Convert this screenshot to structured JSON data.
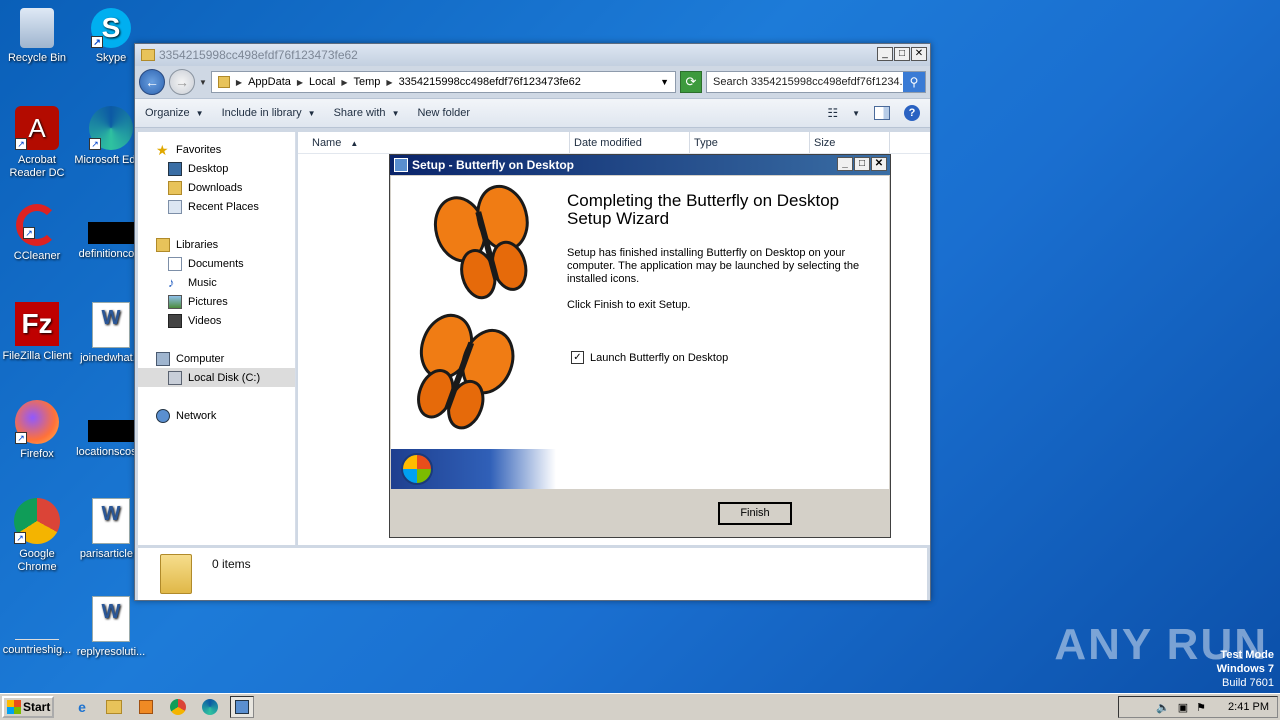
{
  "desktop": {
    "icons": [
      {
        "label": "Recycle Bin"
      },
      {
        "label": "Skype"
      },
      {
        "label": "Acrobat Reader DC"
      },
      {
        "label": "Microsoft Edge"
      },
      {
        "label": "CCleaner"
      },
      {
        "label": "definitionco..."
      },
      {
        "label": "FileZilla Client"
      },
      {
        "label": "joinedwhat..."
      },
      {
        "label": "Firefox"
      },
      {
        "label": "locationscos..."
      },
      {
        "label": "Google Chrome"
      },
      {
        "label": "parisarticle..."
      },
      {
        "label": "countrieshig..."
      },
      {
        "label": "replyresoluti..."
      }
    ]
  },
  "explorer": {
    "title": "3354215998cc498efdf76f123473fe62",
    "breadcrumb": [
      "AppData",
      "Local",
      "Temp",
      "3354215998cc498efdf76f123473fe62"
    ],
    "search_placeholder": "Search 3354215998cc498efdf76f1234...",
    "toolbar": {
      "organize": "Organize",
      "include": "Include in library",
      "share": "Share with",
      "new_folder": "New folder"
    },
    "nav": {
      "favorites": "Favorites",
      "desktop": "Desktop",
      "downloads": "Downloads",
      "recent": "Recent Places",
      "libraries": "Libraries",
      "documents": "Documents",
      "music": "Music",
      "pictures": "Pictures",
      "videos": "Videos",
      "computer": "Computer",
      "local_disk": "Local Disk (C:)",
      "network": "Network"
    },
    "columns": [
      "Name",
      "Date modified",
      "Type",
      "Size"
    ],
    "item_count": "0 items"
  },
  "setup": {
    "title": "Setup - Butterfly on Desktop",
    "heading": "Completing the Butterfly on Desktop Setup Wizard",
    "para1": "Setup has finished installing Butterfly on Desktop on your computer. The application may be launched by selecting the installed icons.",
    "para2": "Click Finish to exit Setup.",
    "checkbox_label": "Launch Butterfly on Desktop",
    "checkbox_checked": true,
    "finish_label": "Finish"
  },
  "taskbar": {
    "start": "Start",
    "clock": "2:41 PM"
  },
  "watermark": "ANY RUN",
  "testmode": {
    "line1": "Test Mode",
    "line2": "Windows 7",
    "line3": "Build 7601"
  }
}
